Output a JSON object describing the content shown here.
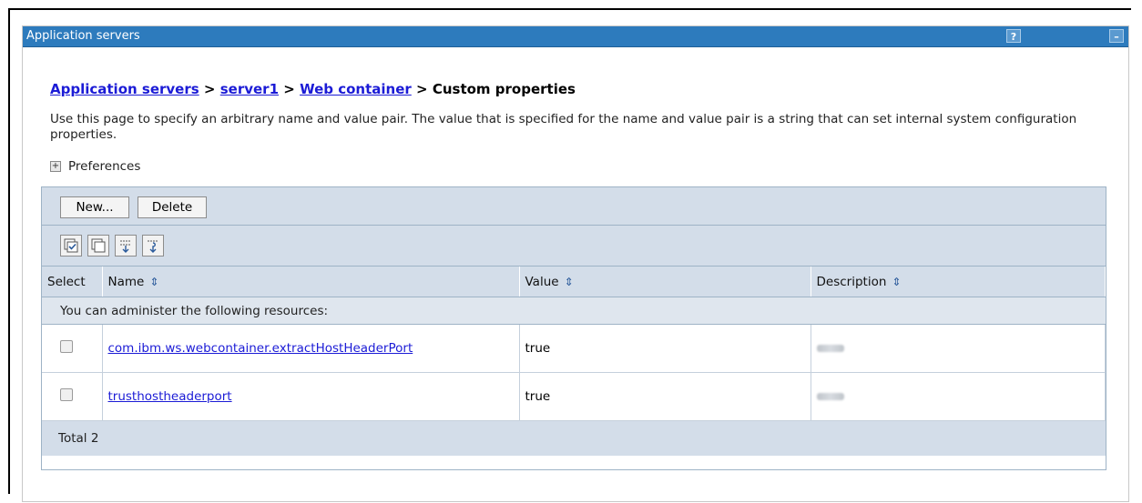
{
  "portlet": {
    "title": "Application servers",
    "help_label": "?",
    "minimize_label": "–"
  },
  "breadcrumb": {
    "items": [
      "Application servers",
      "server1",
      "Web container"
    ],
    "separator": ">",
    "current": "Custom properties"
  },
  "description": "Use this page to specify an arbitrary name and value pair. The value that is specified for the name and value pair is a string that can set internal system configuration properties.",
  "preferences": {
    "expander": "+",
    "label": "Preferences"
  },
  "toolbar": {
    "new_label": "New...",
    "delete_label": "Delete",
    "icons": [
      "select-all-icon",
      "deselect-all-icon",
      "show-filter-icon",
      "clear-filter-icon"
    ]
  },
  "table": {
    "columns": {
      "select": "Select",
      "name": "Name",
      "value": "Value",
      "description": "Description"
    },
    "sort_glyph": "⇕",
    "info": "You can administer the following resources:",
    "rows": [
      {
        "name": "com.ibm.ws.webcontainer.extractHostHeaderPort",
        "value": "true",
        "description_redacted": true
      },
      {
        "name": "trusthostheaderport",
        "value": "true",
        "description_redacted": true
      }
    ],
    "total": "Total 2"
  },
  "colors": {
    "titlebar": "#2d7bbd",
    "panel_header": "#d3dde9",
    "link": "#1b1bd6"
  }
}
